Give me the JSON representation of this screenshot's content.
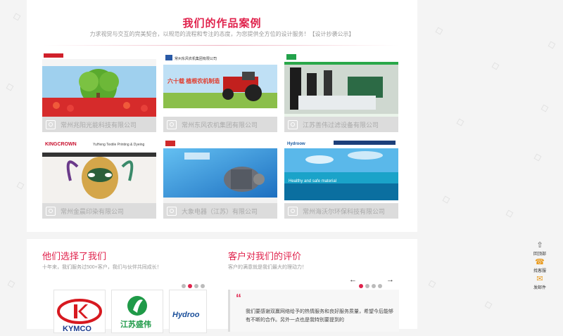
{
  "cases": {
    "title": "我们的作品案例",
    "subtitle": "力求视觉与交互的完美契合，以规范的流程和专注的态度，为您提供全方位的设计服务！【设计抄袭公示】",
    "items": [
      {
        "caption": "常州兆阳光能科技有限公司"
      },
      {
        "caption": "常州东风农机集团有限公司"
      },
      {
        "caption": "江苏善伟过滤设备有限公司"
      },
      {
        "caption": "常州金晨印染有限公司"
      },
      {
        "caption": "大象电器（江苏）有限公司"
      },
      {
        "caption": "常州海沃尔环保科技有限公司"
      }
    ]
  },
  "clients": {
    "title": "他们选择了我们",
    "subtitle": "十年来，我们服务过500+客户，我们与伙伴共同成长！",
    "logos": [
      "KYMCO",
      "江苏盛伟",
      "Hydroo"
    ]
  },
  "reviews": {
    "title": "客户对我们的评价",
    "subtitle": "客户的满意就是我们最大的理动力！",
    "quote_mark": "“",
    "text": "我们要感谢双赢网络给予的热情服务和良好服务质量，希望今后能够有不断的合作。另外一点也是我特别要提到的",
    "prev": "←",
    "next": "→"
  },
  "sidebar": [
    {
      "label": "回顶部",
      "icon": "back-to-top-icon"
    },
    {
      "label": "找客服",
      "icon": "customer-service-icon"
    },
    {
      "label": "发邮件",
      "icon": "mail-icon"
    }
  ],
  "thumb_text": {
    "c2_header": "常州东风农机集团有限公司",
    "c2_banner": "六十载 植根农机制造",
    "c4_brand": "KINGCROWN",
    "c4_name": "YuHeng Textile Printing & Dyeing",
    "c6_tag": "Healthy and safe material",
    "c6_logo": "Hydroow"
  },
  "colors": {
    "accent": "#e0224c"
  }
}
